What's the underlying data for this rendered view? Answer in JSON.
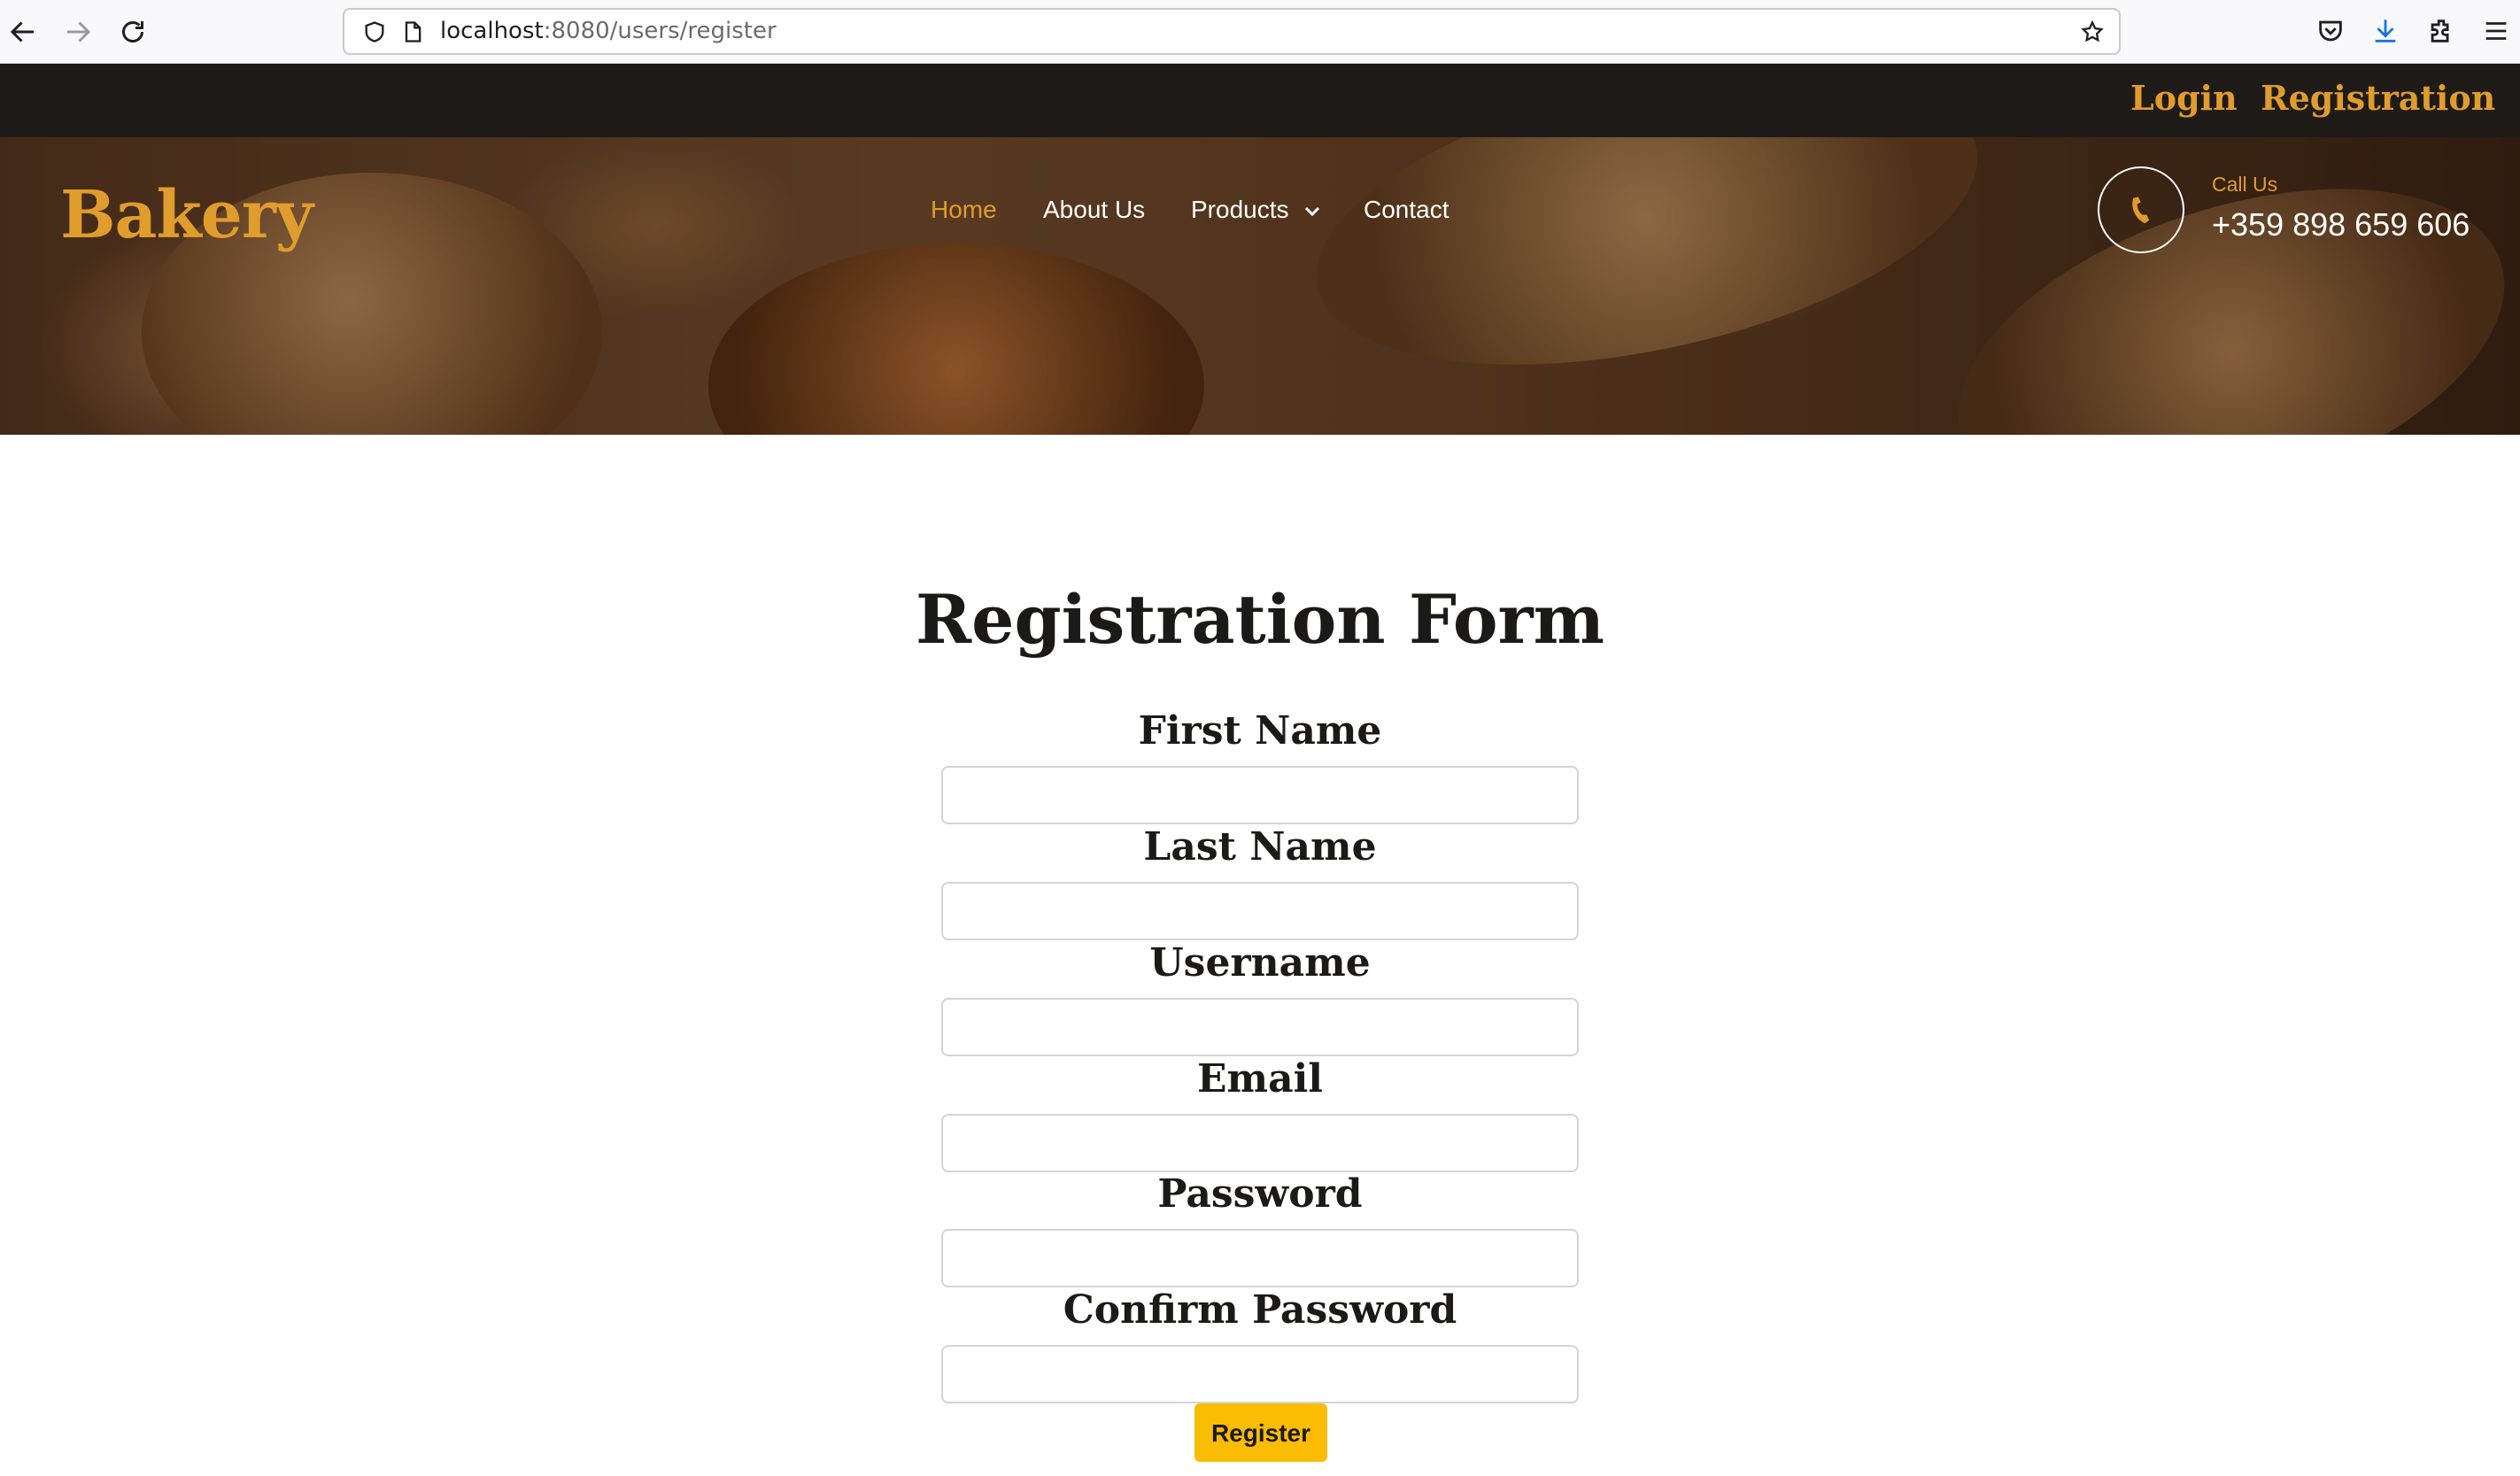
{
  "browser": {
    "url_host": "localhost",
    "url_rest": ":8080/users/register"
  },
  "topbar": {
    "login": "Login",
    "registration": "Registration"
  },
  "hero": {
    "brand": "Bakery",
    "menu": [
      "Home",
      "About Us",
      "Products",
      "Contact"
    ],
    "call_label": "Call Us",
    "phone": "+359 898 659 606"
  },
  "form": {
    "title": "Registration Form",
    "fields": [
      "First Name",
      "Last Name",
      "Username",
      "Email",
      "Password",
      "Confirm Password"
    ],
    "submit": "Register"
  },
  "colors": {
    "accent": "#e09c2c",
    "topbar": "#1e1b19",
    "button": "#fbbc04"
  }
}
